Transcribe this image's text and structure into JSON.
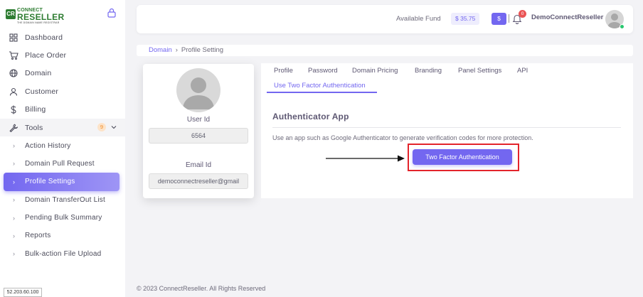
{
  "logo": {
    "line1": "CONNECT",
    "line2": "RESELLER",
    "tagline": "THE DOMAIN NAME REGISTRAR"
  },
  "sidebar": {
    "items": [
      {
        "label": "Dashboard",
        "icon": "grid-icon"
      },
      {
        "label": "Place Order",
        "icon": "cart-icon"
      },
      {
        "label": "Domain",
        "icon": "globe-icon"
      },
      {
        "label": "Customer",
        "icon": "user-icon"
      },
      {
        "label": "Billing",
        "icon": "dollar-icon"
      },
      {
        "label": "Tools",
        "icon": "tool-icon",
        "badge": "9"
      }
    ],
    "subitems": [
      "Action History",
      "Domain Pull Request",
      "Profile Settings",
      "Domain TransferOut List",
      "Pending Bulk Summary",
      "Reports",
      "Bulk-action File Upload"
    ],
    "active_subitem": "Profile Settings"
  },
  "ip_address": "52.203.60.100",
  "header": {
    "fund_label": "Available Fund",
    "fund_value": "$ 35.75",
    "currency_button": "$",
    "notification_count": "0",
    "username": "DemoConnectReseller"
  },
  "breadcrumb": {
    "parent": "Domain",
    "separator": "›",
    "current": "Profile Setting"
  },
  "profile": {
    "user_id_label": "User Id",
    "user_id_value": "6564",
    "email_label": "Email Id",
    "email_value": "democonnectreseller@gmail"
  },
  "tabs": [
    "Profile",
    "Password",
    "Domain Pricing",
    "Branding",
    "Panel Settings",
    "API",
    "Use Two Factor Authentication"
  ],
  "active_tab": "Use Two Factor Authentication",
  "authenticator": {
    "title": "Authenticator App",
    "description": "Use an app such as Google Authenticator to generate verification codes for more protection.",
    "button_label": "Two Factor Authentication"
  },
  "footer": "© 2023 ConnectReseller. All Rights Reserved",
  "colors": {
    "accent": "#7367f0",
    "highlight": "#e3242b",
    "brand_green": "#2e7d32",
    "badge_orange": "#f08a24",
    "online": "#28c76f"
  }
}
